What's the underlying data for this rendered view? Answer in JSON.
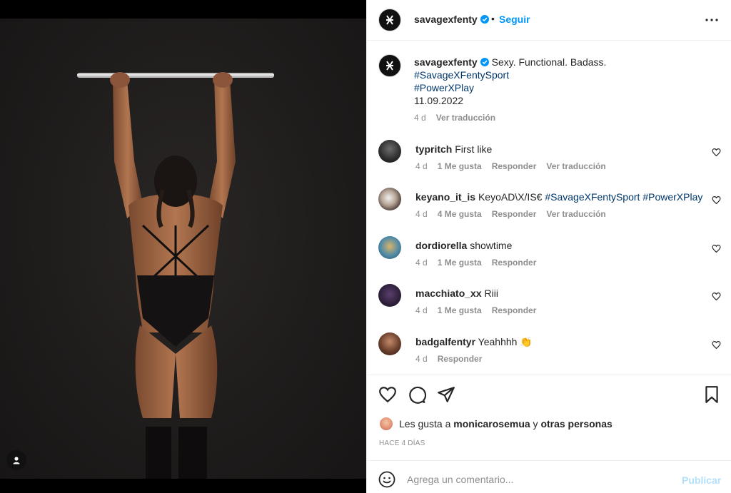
{
  "post": {
    "author": "savagexfenty",
    "follow_label": "Seguir",
    "dot": "•",
    "caption": {
      "text": "Sexy. Functional. Badass.",
      "hashtags": [
        "#SavageXFentySport",
        "#PowerXPlay"
      ],
      "date": "11.09.2022",
      "time": "4 d",
      "translate": "Ver traducción"
    },
    "comments": [
      {
        "user": "typritch",
        "text": "First like",
        "time": "4 d",
        "likes": "1 Me gusta",
        "reply": "Responder",
        "translate": "Ver traducción"
      },
      {
        "user": "keyano_it_is",
        "text": "KeyoAD\\X/IS€",
        "tags": "#SavageXFentySport #PowerXPlay",
        "time": "4 d",
        "likes": "4 Me gusta",
        "reply": "Responder",
        "translate": "Ver traducción"
      },
      {
        "user": "dordiorella",
        "text": "showtime",
        "time": "4 d",
        "likes": "1 Me gusta",
        "reply": "Responder"
      },
      {
        "user": "macchiato_xx",
        "text": "Riii",
        "time": "4 d",
        "likes": "1 Me gusta",
        "reply": "Responder"
      },
      {
        "user": "badgalfentyr",
        "text": "Yeahhhh 👏",
        "time": "4 d",
        "reply": "Responder"
      }
    ],
    "likes": {
      "prefix": "Les gusta a",
      "user": "monicarosemua",
      "joiner": "y",
      "others": "otras personas"
    },
    "ago": "HACE 4 DÍAS",
    "composer": {
      "placeholder": "Agrega un comentario...",
      "publish_label": "Publicar"
    }
  },
  "colors": {
    "link_blue": "#0095f6",
    "hashtag": "#00376b",
    "muted": "#8e8e8e",
    "publish_disabled": "#b2dffc"
  },
  "icons": [
    "verified-badge-icon",
    "more-options-icon",
    "heart-icon",
    "comment-icon",
    "share-icon",
    "bookmark-icon",
    "emoji-icon",
    "user-tag-icon"
  ]
}
